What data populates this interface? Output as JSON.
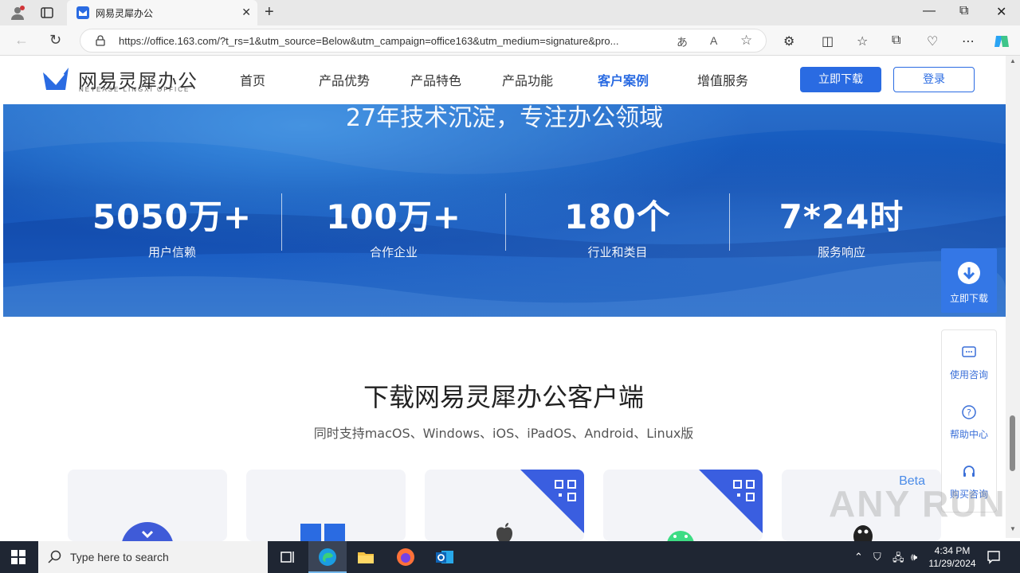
{
  "browser": {
    "tab_title": "网易灵犀办公",
    "url": "https://office.163.com/?t_rs=1&utm_source=Below&utm_campaign=office163&utm_medium=signature&pro...",
    "new_tab_label": "+",
    "close_tab_label": "✕",
    "minimize_label": "—",
    "maximize_label": "⧉",
    "close_window_label": "✕"
  },
  "site": {
    "logo_cn": "网易灵犀办公",
    "logo_en": "NETEASE LINGXI OFFICE",
    "nav": [
      {
        "label": "首页",
        "active": false
      },
      {
        "label": "产品优势",
        "active": false
      },
      {
        "label": "产品特色",
        "active": false
      },
      {
        "label": "产品功能",
        "active": false
      },
      {
        "label": "客户案例",
        "active": true
      },
      {
        "label": "增值服务",
        "active": false
      }
    ],
    "download_btn": "立即下载",
    "login_btn": "登录"
  },
  "banner": {
    "title": "27年技术沉淀，专注办公领域",
    "stats": [
      {
        "value": "5050万+",
        "label": "用户信赖"
      },
      {
        "value": "100万+",
        "label": "合作企业"
      },
      {
        "value": "180个",
        "label": "行业和类目"
      },
      {
        "value": "7*24时",
        "label": "服务响应"
      }
    ]
  },
  "download_section": {
    "title": "下载网易灵犀办公客户端",
    "subtitle": "同时支持macOS、Windows、iOS、iPadOS、Android、Linux版",
    "cards": [
      {
        "platform": "macos-icon",
        "qr": false
      },
      {
        "platform": "windows-icon",
        "qr": false
      },
      {
        "platform": "apple-icon",
        "qr": true
      },
      {
        "platform": "android-icon",
        "qr": true
      },
      {
        "platform": "linux-icon",
        "qr": false,
        "badge": "Beta"
      }
    ]
  },
  "float": {
    "download_label": "立即下载",
    "items": [
      {
        "label": "使用咨询",
        "icon": "chat-icon"
      },
      {
        "label": "帮助中心",
        "icon": "help-icon"
      },
      {
        "label": "购买咨询",
        "icon": "headset-icon"
      }
    ]
  },
  "watermark": "ANY RUN",
  "taskbar": {
    "search_placeholder": "Type here to search",
    "time": "4:34 PM",
    "date": "11/29/2024"
  },
  "colors": {
    "brand": "#2a6be2",
    "banner": "#1452b4",
    "taskbar": "#1f2633"
  }
}
